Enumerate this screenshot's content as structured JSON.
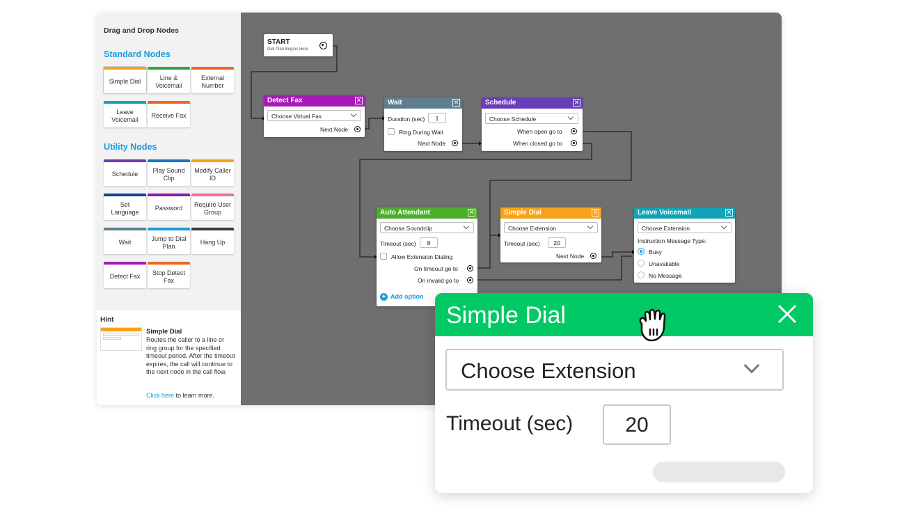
{
  "sidebar": {
    "title": "Drag and Drop Nodes",
    "standard_heading": "Standard Nodes",
    "standard_nodes": [
      {
        "label": "Simple Dial",
        "color": "#f7a21a"
      },
      {
        "label": "Line & Voicemail",
        "color": "#2ba84a"
      },
      {
        "label": "External Number",
        "color": "#f26522"
      },
      {
        "label": "Leave Voicemail",
        "color": "#12a3b8"
      },
      {
        "label": "Receive Fax",
        "color": "#f26522"
      }
    ],
    "utility_heading": "Utility Nodes",
    "utility_nodes": [
      {
        "label": "Schedule",
        "color": "#6a3db8"
      },
      {
        "label": "Play Sound Clip",
        "color": "#1a73c9"
      },
      {
        "label": "Modify Caller ID",
        "color": "#f7a21a"
      },
      {
        "label": "Set Language",
        "color": "#1a3f8f"
      },
      {
        "label": "Password",
        "color": "#8b1aa8"
      },
      {
        "label": "Require User Group",
        "color": "#f06fa0"
      },
      {
        "label": "Wait",
        "color": "#5f7d8e"
      },
      {
        "label": "Jump to Dial Plan",
        "color": "#1a9be0"
      },
      {
        "label": "Hang Up",
        "color": "#3a3a3a"
      },
      {
        "label": "Detect Fax",
        "color": "#a81ab8"
      },
      {
        "label": "Stop Detect Fax",
        "color": "#f26522"
      }
    ]
  },
  "hint": {
    "title": "Hint",
    "thumb_rows": [
      "Choose Extension",
      "Timeout (sec)",
      "20",
      "Next Node"
    ],
    "node_name": "Simple Dial",
    "description": "Routes the caller to a line or ring group for the specified timeout period. After the timeout expires, the call will continue to the next node in the call flow.",
    "link_text": "Click here",
    "link_suffix": " to learn more."
  },
  "canvas": {
    "start": {
      "title": "START",
      "subtitle": "Dial Plan Begins Here"
    },
    "detect_fax": {
      "title": "Detect Fax",
      "select": "Choose Virtual Fax",
      "next": "Next Node",
      "color": "#a81ab8"
    },
    "wait": {
      "title": "Wait",
      "duration_label": "Duration (sec)",
      "duration": "1",
      "ring_label": "Ring During Wait",
      "next": "Next Node",
      "color": "#5f7d8e"
    },
    "schedule": {
      "title": "Schedule",
      "select": "Choose Schedule",
      "open": "When open go to",
      "closed": "When closed go to",
      "color": "#6a3db8"
    },
    "auto_attendant": {
      "title": "Auto Attendant",
      "select": "Choose Soundclip",
      "timeout_label": "Timeout (sec)",
      "timeout": "8",
      "ext_label": "Allow Extension Dialing",
      "on_timeout": "On timeout go to",
      "on_invalid": "On invalid go to",
      "add_option": "Add option",
      "color": "#4caf2a"
    },
    "simple_dial": {
      "title": "Simple Dial",
      "select": "Choose Extension",
      "timeout_label": "Timeout (sec)",
      "timeout": "20",
      "next": "Next Node",
      "color": "#f7a21a"
    },
    "leave_voicemail": {
      "title": "Leave Voicemail",
      "select": "Choose Extension",
      "type_label": "Instruction Message Type:",
      "options": [
        "Busy",
        "Unavailable",
        "No Message"
      ],
      "selected": "Busy",
      "color": "#12a3b8"
    },
    "close_glyph": "✕"
  },
  "zoom": {
    "title": "Simple Dial",
    "select": "Choose Extension",
    "timeout_label": "Timeout (sec)",
    "timeout": "20",
    "header_color": "#00c965"
  }
}
